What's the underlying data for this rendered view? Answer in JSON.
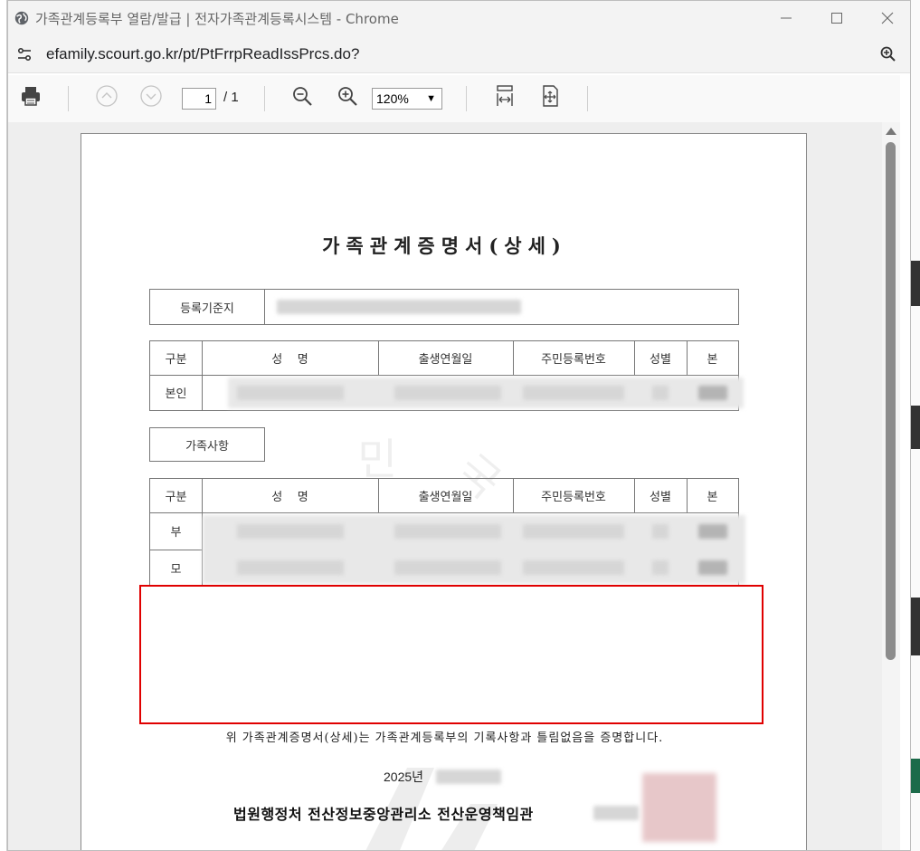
{
  "window": {
    "title": "가족관계등록부 열람/발급 | 전자가족관계등록시스템 - Chrome",
    "url": "efamily.scourt.go.kr/pt/PtFrrpReadIssPrcs.do?"
  },
  "pdf_toolbar": {
    "page_current": "1",
    "page_total": "/ 1",
    "zoom_level": "120%"
  },
  "document": {
    "title": "가족관계증명서(상세)",
    "base_label": "등록기준지",
    "table_headers": {
      "category": "구분",
      "name": "성    명",
      "birth": "출생연월일",
      "rrn": "주민등록번호",
      "sex": "성별",
      "origin": "본"
    },
    "self_label": "본인",
    "family_section_label": "가족사항",
    "family_rows": [
      "부",
      "모"
    ],
    "watermark_chars": [
      "민",
      "국"
    ],
    "certify_text": "위 가족관계증명서(상세)는 가족관계등록부의 기록사항과 틀림없음을 증명합니다.",
    "year_text": "2025년",
    "issuer": "법원행정처 전산정보중앙관리소 전산운영책임관"
  },
  "colors": {
    "highlight_border": "#e00000",
    "seal": "#e7c7c9"
  }
}
